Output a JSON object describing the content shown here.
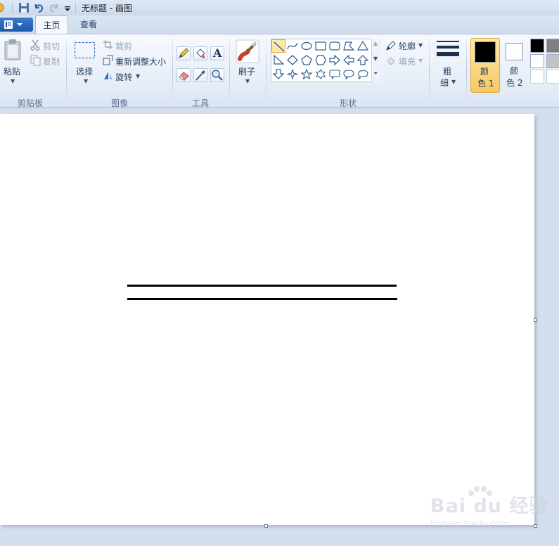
{
  "window": {
    "title": "无标题 - 画图"
  },
  "tabs": [
    {
      "label": "主页",
      "active": true
    },
    {
      "label": "查看",
      "active": false
    }
  ],
  "clipboard": {
    "paste_label": "粘贴",
    "cut_label": "剪切",
    "copy_label": "复制",
    "group_label": "剪贴板"
  },
  "image": {
    "select_label": "选择",
    "crop_label": "裁剪",
    "resize_label": "重新调整大小",
    "rotate_label": "旋转",
    "group_label": "图像"
  },
  "tools": {
    "group_label": "工具",
    "text_tool_glyph": "A"
  },
  "brushes": {
    "label": "刷子"
  },
  "shapes": {
    "outline_label": "轮廓",
    "fill_label": "填充",
    "group_label": "形状",
    "selected_shape": "line"
  },
  "size": {
    "label_top": "粗",
    "label_bottom": "细"
  },
  "colors": {
    "color1_top": "颜",
    "color1_bottom": "色 1",
    "color2_top": "颜",
    "color2_bottom": "色 2",
    "color1_value": "#000000",
    "color2_value": "#ffffff",
    "palette": [
      "#000000",
      "#7f7f7f",
      "#ffffff",
      "#c3c3c3",
      "#ffffff",
      "#ffffff"
    ]
  },
  "canvas": {
    "background": "#ffffff",
    "stroke_color": "#000000"
  },
  "watermark": {
    "main": "Bai du 经验",
    "sub": "jingyan.baidu.com"
  }
}
